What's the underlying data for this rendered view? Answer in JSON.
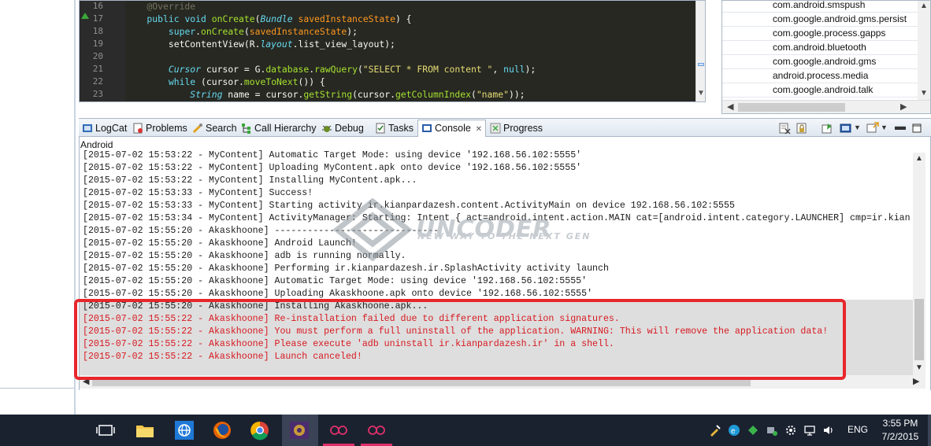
{
  "editor": {
    "lines": [
      {
        "n": "16",
        "tokens": [
          [
            "cm",
            "    @Override"
          ]
        ]
      },
      {
        "n": "17",
        "tokens": [
          [
            "kw",
            "    public "
          ],
          [
            "kw",
            "void "
          ],
          [
            "kw2",
            "onCreate"
          ],
          [
            "",
            "("
          ],
          [
            "ty",
            "Bundle"
          ],
          [
            "",
            " "
          ],
          [
            "or",
            "savedInstanceState"
          ],
          [
            "",
            ") {"
          ]
        ]
      },
      {
        "n": "18",
        "tokens": [
          [
            "",
            "        "
          ],
          [
            "kw",
            "super"
          ],
          [
            "",
            "."
          ],
          [
            "kw2",
            "onCreate"
          ],
          [
            "",
            "("
          ],
          [
            "or",
            "savedInstanceState"
          ],
          [
            "",
            ");"
          ]
        ]
      },
      {
        "n": "19",
        "tokens": [
          [
            "",
            "        setContentView(R."
          ],
          [
            "ty",
            "layout"
          ],
          [
            "",
            ".list_view_layout);"
          ]
        ]
      },
      {
        "n": "20",
        "tokens": [
          [
            "",
            ""
          ]
        ]
      },
      {
        "n": "21",
        "tokens": [
          [
            "",
            "        "
          ],
          [
            "ty",
            "Cursor"
          ],
          [
            "",
            " cursor = G."
          ],
          [
            "kw2",
            "database"
          ],
          [
            "",
            "."
          ],
          [
            "kw2",
            "rawQuery"
          ],
          [
            "",
            "("
          ],
          [
            "str",
            "\"SELECT * FROM content \""
          ],
          [
            "",
            ", "
          ],
          [
            "kw",
            "null"
          ],
          [
            "",
            ");"
          ]
        ]
      },
      {
        "n": "22",
        "tokens": [
          [
            "",
            "        "
          ],
          [
            "kw",
            "while"
          ],
          [
            "",
            " (cursor."
          ],
          [
            "kw2",
            "moveToNext"
          ],
          [
            "",
            "()) {"
          ]
        ]
      },
      {
        "n": "23",
        "tokens": [
          [
            "",
            "            "
          ],
          [
            "ty",
            "String"
          ],
          [
            "",
            " name = cursor."
          ],
          [
            "kw2",
            "getString"
          ],
          [
            "",
            "(cursor."
          ],
          [
            "kw2",
            "getColumnIndex"
          ],
          [
            "",
            "("
          ],
          [
            "str",
            "\"name\""
          ],
          [
            "",
            "));"
          ]
        ]
      }
    ]
  },
  "processes": [
    "com.android.smspush",
    "com.google.android.gms.persist",
    "com.google.process.gapps",
    "com.android.bluetooth",
    "com.google.android.gms",
    "android.process.media",
    "com.google.android.talk"
  ],
  "tabs": [
    {
      "label": "LogCat",
      "icon": "logcat-icon"
    },
    {
      "label": "Problems",
      "icon": "problems-icon"
    },
    {
      "label": "Search",
      "icon": "search-icon"
    },
    {
      "label": "Call Hierarchy",
      "icon": "call-hierarchy-icon"
    },
    {
      "label": "Debug",
      "icon": "debug-icon"
    },
    {
      "label": "Tasks",
      "icon": "tasks-icon"
    },
    {
      "label": "Console",
      "icon": "console-icon",
      "active": true
    },
    {
      "label": "Progress",
      "icon": "progress-icon"
    }
  ],
  "console": {
    "title": "Android",
    "lines": [
      {
        "text": "[2015-07-02 15:53:22 - MyContent] Automatic Target Mode: using device '192.168.56.102:5555'",
        "error": false
      },
      {
        "text": "[2015-07-02 15:53:22 - MyContent] Uploading MyContent.apk onto device '192.168.56.102:5555'",
        "error": false
      },
      {
        "text": "[2015-07-02 15:53:22 - MyContent] Installing MyContent.apk...",
        "error": false
      },
      {
        "text": "[2015-07-02 15:53:33 - MyContent] Success!",
        "error": false
      },
      {
        "text": "[2015-07-02 15:53:33 - MyContent] Starting activity ir.kianpardazesh.content.ActivityMain on device 192.168.56.102:5555",
        "error": false
      },
      {
        "text": "[2015-07-02 15:53:34 - MyContent] ActivityManager: Starting: Intent { act=android.intent.action.MAIN cat=[android.intent.category.LAUNCHER] cmp=ir.kian",
        "error": false
      },
      {
        "text": "[2015-07-02 15:55:20 - Akaskhoone] ------------------------------",
        "error": false
      },
      {
        "text": "[2015-07-02 15:55:20 - Akaskhoone] Android Launch!",
        "error": false
      },
      {
        "text": "[2015-07-02 15:55:20 - Akaskhoone] adb is running normally.",
        "error": false
      },
      {
        "text": "[2015-07-02 15:55:20 - Akaskhoone] Performing ir.kianpardazesh.ir.SplashActivity activity launch",
        "error": false
      },
      {
        "text": "[2015-07-02 15:55:20 - Akaskhoone] Automatic Target Mode: using device '192.168.56.102:5555'",
        "error": false
      },
      {
        "text": "[2015-07-02 15:55:20 - Akaskhoone] Uploading Akaskhoone.apk onto device '192.168.56.102:5555'",
        "error": false
      },
      {
        "text": "[2015-07-02 15:55:20 - Akaskhoone] Installing Akaskhoone.apk...",
        "error": false
      },
      {
        "text": "[2015-07-02 15:55:22 - Akaskhoone] Re-installation failed due to different application signatures.",
        "error": true
      },
      {
        "text": "[2015-07-02 15:55:22 - Akaskhoone] You must perform a full uninstall of the application. WARNING: This will remove the application data!",
        "error": true
      },
      {
        "text": "[2015-07-02 15:55:22 - Akaskhoone] Please execute 'adb uninstall ir.kianpardazesh.ir' in a shell.",
        "error": true
      },
      {
        "text": "[2015-07-02 15:55:22 - Akaskhoone] Launch canceled!",
        "error": true
      }
    ]
  },
  "watermark": {
    "title": "UNCODER",
    "subtitle": "NEW WAY TO THE NEXT GEN"
  },
  "taskbar": {
    "language": "ENG",
    "time": "3:55 PM",
    "date": "7/2/2015"
  },
  "colors": {
    "error": "#d71920",
    "highlight": "#e8262b",
    "taskbar": "#1a2230"
  }
}
